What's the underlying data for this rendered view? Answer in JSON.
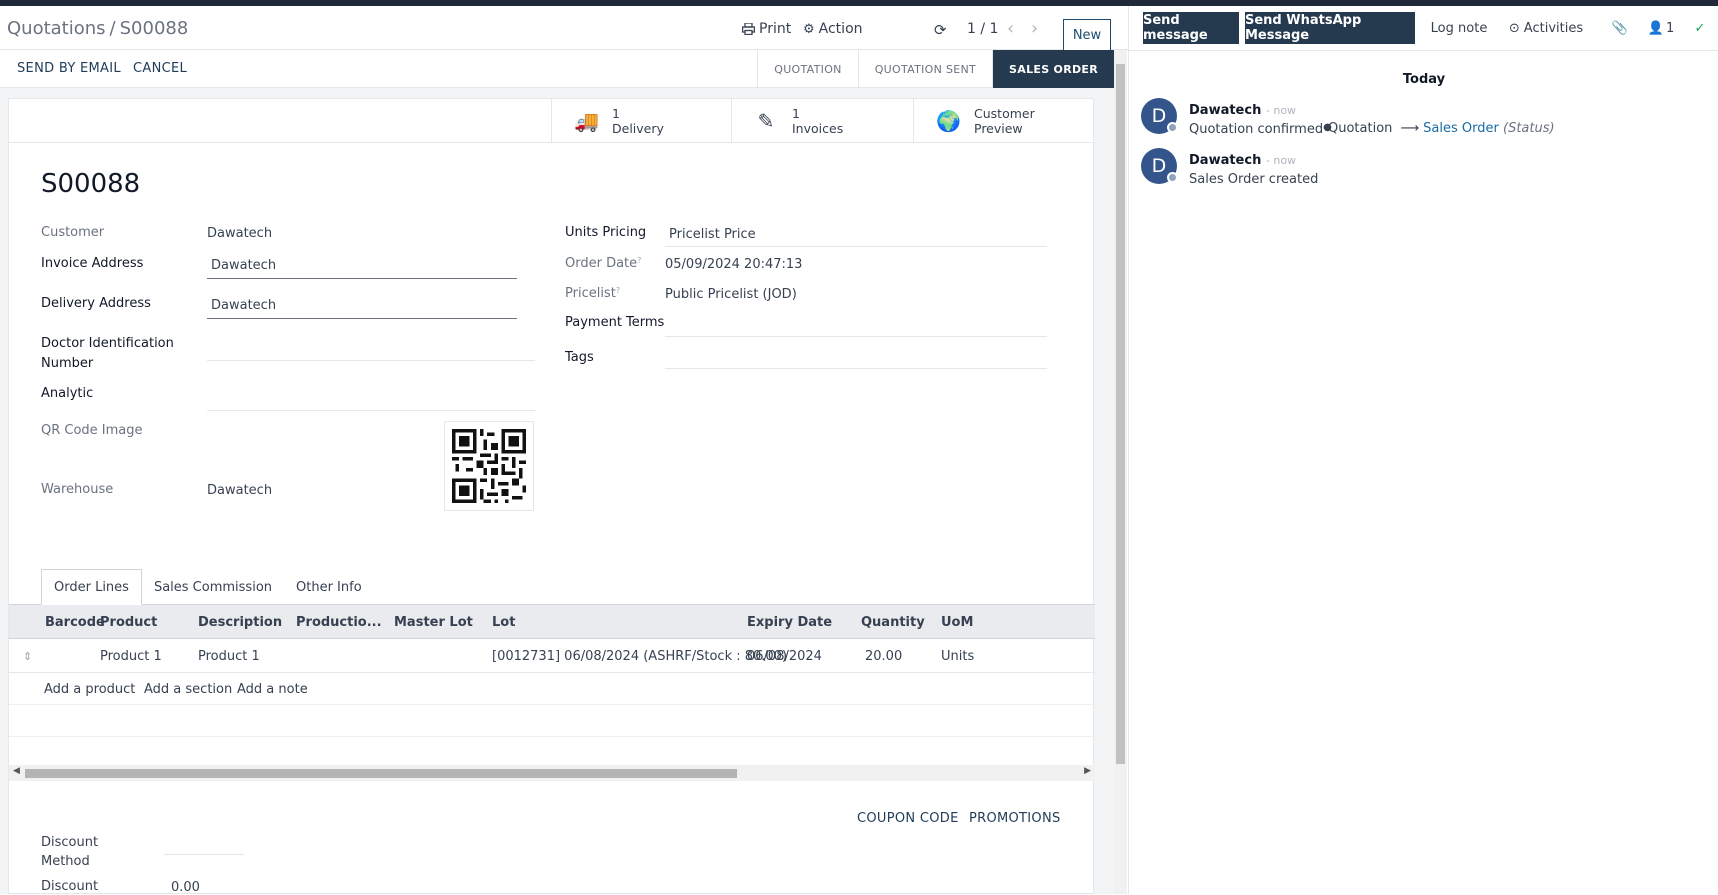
{
  "breadcrumb": {
    "parent": "Quotations",
    "separator": "/",
    "current": "S00088"
  },
  "toolbar": {
    "print": "Print",
    "action": "Action",
    "pager": "1 / 1",
    "new": "New"
  },
  "statusbar": {
    "buttons": [
      "SEND BY EMAIL",
      "CANCEL"
    ],
    "stages": [
      "QUOTATION",
      "QUOTATION SENT",
      "SALES ORDER"
    ],
    "active_stage": "SALES ORDER"
  },
  "smart_buttons": [
    {
      "icon": "truck-icon",
      "count": "1",
      "label": "Delivery"
    },
    {
      "icon": "edit-icon",
      "count": "1",
      "label": "Invoices"
    },
    {
      "icon": "globe-icon",
      "count": "Customer",
      "label": "Preview"
    }
  ],
  "form": {
    "title": "S00088",
    "customer_label": "Customer",
    "customer": "Dawatech",
    "invoice_label": "Invoice Address",
    "invoice": "Dawatech",
    "delivery_label": "Delivery Address",
    "delivery": "Dawatech",
    "doctor_label_1": "Doctor Identification",
    "doctor_label_2": "Number",
    "analytic_label": "Analytic",
    "qr_label": "QR Code Image",
    "warehouse_label": "Warehouse",
    "warehouse": "Dawatech",
    "units_pricing_label": "Units Pricing",
    "units_pricing": "Pricelist Price",
    "order_date_label": "Order Date",
    "order_date": "05/09/2024 20:47:13",
    "pricelist_label": "Pricelist",
    "pricelist": "Public Pricelist (JOD)",
    "payment_terms_label": "Payment Terms",
    "tags_label": "Tags",
    "help_mark": "?"
  },
  "tabs": [
    "Order Lines",
    "Sales Commission",
    "Other Info"
  ],
  "order_lines": {
    "columns": [
      "Barcode",
      "Product",
      "Description",
      "Productio...",
      "Master Lot",
      "Lot",
      "Expiry Date",
      "Quantity",
      "UoM"
    ],
    "rows": [
      {
        "barcode": "",
        "product": "Product 1",
        "description": "Product 1",
        "production": "",
        "master_lot": "",
        "lot": "[0012731] 06/08/2024 (ASHRF/Stock : 80.00)",
        "expiry": "06/08/2024",
        "quantity": "20.00",
        "uom": "Units"
      }
    ],
    "add_links": [
      "Add a product",
      "Add a section",
      "Add a note"
    ]
  },
  "footer": {
    "coupon": "COUPON CODE",
    "promotions": "PROMOTIONS",
    "discount_method_1": "Discount",
    "discount_method_2": "Method",
    "discount_label": "Discount",
    "discount_value": "0.00"
  },
  "chatter": {
    "buttons": {
      "send_message": "Send message",
      "whatsapp": "Send WhatsApp Message",
      "log_note": "Log note",
      "activities": "Activities",
      "followers": "1"
    },
    "date_separator": "Today",
    "messages": [
      {
        "initial": "D",
        "author": "Dawatech",
        "time": "- now",
        "body": "Quotation confirmed",
        "old_value": "Quotation",
        "new_value": "Sales Order",
        "field": "(Status)"
      },
      {
        "initial": "D",
        "author": "Dawatech",
        "time": "- now",
        "body": "Sales Order created"
      }
    ]
  },
  "colors": {
    "primary_dark": "#263a4f",
    "link": "#1a6ba6",
    "avatar": "#34558b"
  }
}
